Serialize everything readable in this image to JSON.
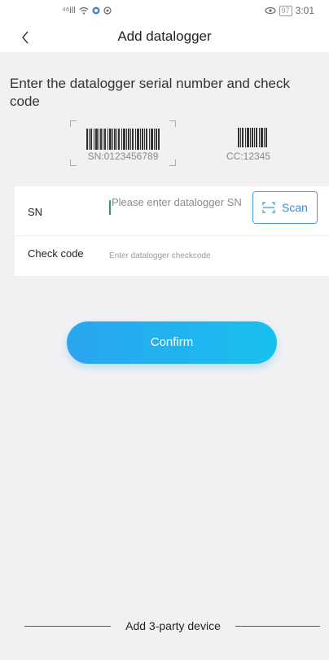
{
  "status_bar": {
    "signal": "⁴⁶ill",
    "time": "3:01",
    "battery": "97",
    "eye_icon": "eye-protect-icon"
  },
  "header": {
    "title": "Add datalogger",
    "back_icon": "chevron-left-icon"
  },
  "instruction": "Enter the datalogger serial number and check code",
  "illustration": {
    "sn_text": "SN:0123456789",
    "cc_text": "CC:12345"
  },
  "form": {
    "sn_label": "SN",
    "sn_placeholder": "Please enter datalogger SN",
    "scan_label": "Scan",
    "scan_icon": "scan-icon",
    "cc_label": "Check code",
    "cc_placeholder": "Enter datalogger checkcode"
  },
  "confirm_label": "Confirm",
  "footer": {
    "add_party_label": "Add 3-party device"
  },
  "colors": {
    "accent": "#2aa5ef",
    "background": "#f1f1f3",
    "scan_border": "#4a9fe0"
  }
}
